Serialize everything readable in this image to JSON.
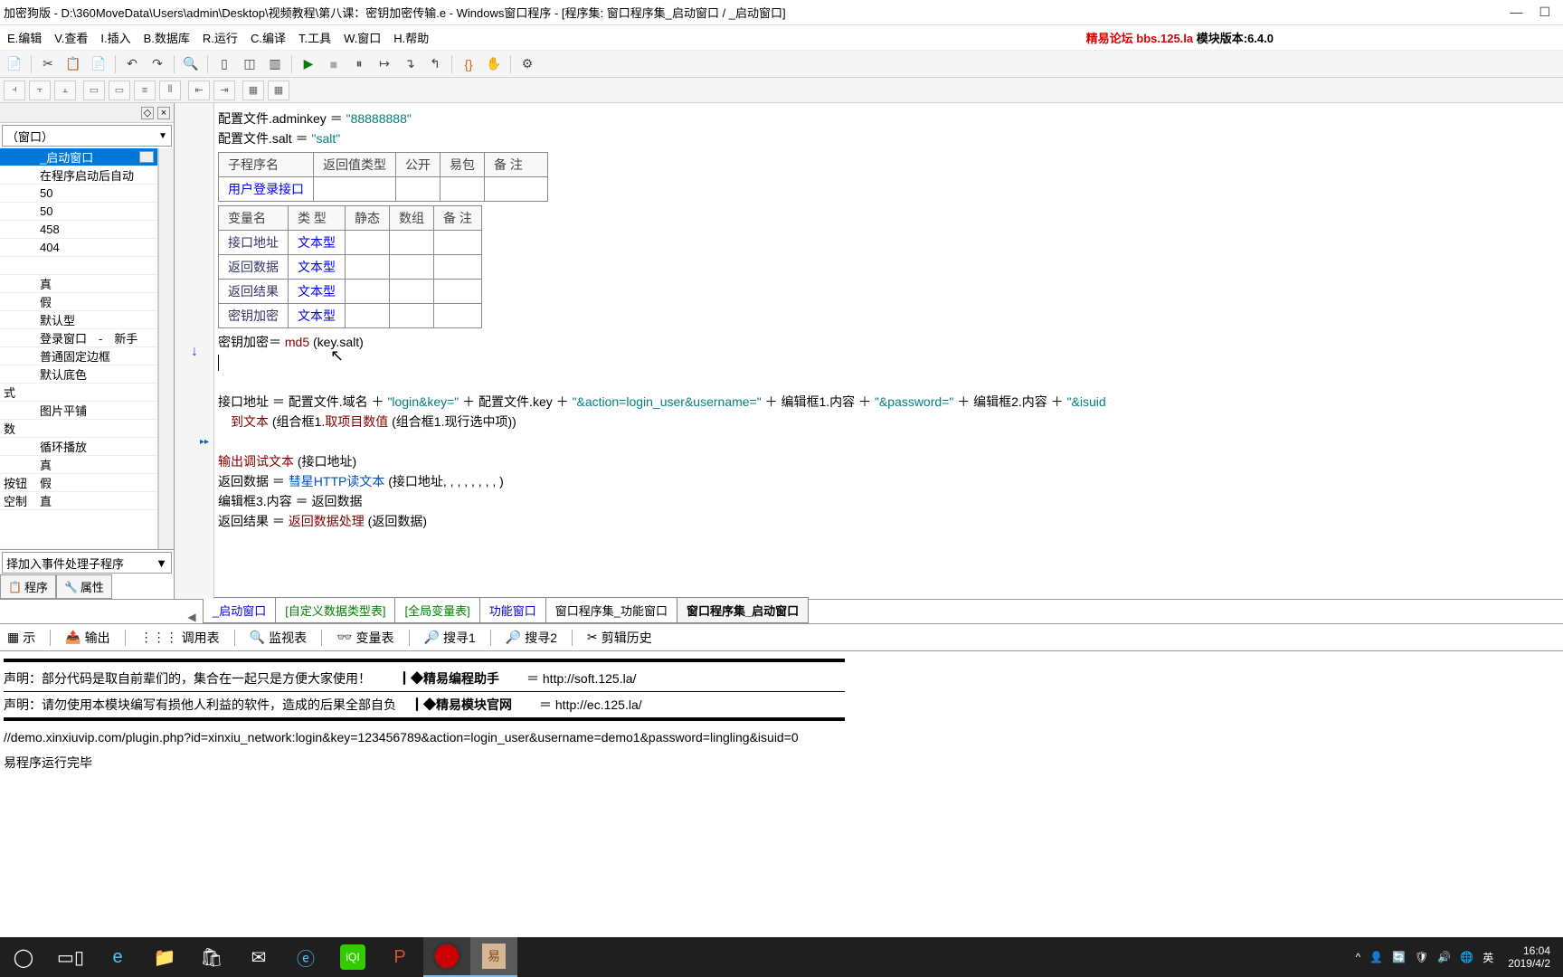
{
  "title": "加密狗版 - D:\\360MoveData\\Users\\admin\\Desktop\\视频教程\\第八课：密钥加密传输.e - Windows窗口程序 - [程序集: 窗口程序集_启动窗口 / _启动窗口]",
  "menus": [
    "E.编辑",
    "V.查看",
    "I.插入",
    "B.数据库",
    "R.运行",
    "C.编译",
    "T.工具",
    "W.窗口",
    "H.帮助"
  ],
  "brand_red": "精易论坛 bbs.125.la ",
  "brand_black": "模块版本:6.4.0",
  "left": {
    "combo": "（窗口）",
    "rows": [
      {
        "a": "",
        "b": "_启动窗口",
        "sel": true,
        "ell": true
      },
      {
        "a": "",
        "b": "在程序启动后自动"
      },
      {
        "a": "",
        "b": "50"
      },
      {
        "a": "",
        "b": "50"
      },
      {
        "a": "",
        "b": "458"
      },
      {
        "a": "",
        "b": "404"
      },
      {
        "a": "",
        "b": ""
      },
      {
        "a": "",
        "b": "真"
      },
      {
        "a": "",
        "b": "假"
      },
      {
        "a": "",
        "b": "默认型"
      },
      {
        "a": "",
        "b": "登录窗口　-　新手"
      },
      {
        "a": "",
        "b": "普通固定边框"
      },
      {
        "a": "",
        "b": "默认底色"
      },
      {
        "a": "式",
        "b": ""
      },
      {
        "a": "",
        "b": "图片平铺"
      },
      {
        "a": "数",
        "b": ""
      },
      {
        "a": "",
        "b": "循环播放"
      },
      {
        "a": "",
        "b": "真"
      },
      {
        "a": "按钮",
        "b": "假"
      },
      {
        "a": "空制",
        "b": "直"
      }
    ],
    "addevent": "择加入事件处理子程序",
    "tabs": [
      {
        "icon": "📋",
        "label": "程序"
      },
      {
        "icon": "🔧",
        "label": "属性"
      }
    ]
  },
  "code": {
    "l1a": "配置文件.adminkey ＝ ",
    "l1b": "\"88888888\"",
    "l2a": "配置文件.salt ＝ ",
    "l2b": "\"salt\"",
    "th1": [
      "子程序名",
      "返回值类型",
      "公开",
      "易包",
      "备 注"
    ],
    "tr1": [
      "用户登录接口",
      "",
      "",
      "",
      ""
    ],
    "th2": [
      "变量名",
      "类 型",
      "静态",
      "数组",
      "备 注"
    ],
    "tr2a": [
      "接口地址",
      "文本型",
      "",
      "",
      ""
    ],
    "tr2b": [
      "返回数据",
      "文本型",
      "",
      "",
      ""
    ],
    "tr2c": [
      "返回结果",
      "文本型",
      "",
      "",
      ""
    ],
    "tr2d": [
      "密钥加密",
      "文本型",
      "",
      "",
      ""
    ],
    "l3a": "密钥加密＝ ",
    "l3fn": "md5",
    "l3b": " (key.salt)",
    "l4a": "接口地址 ＝ 配置文件.域名 ＋ ",
    "l4s1": "\"login&key=\"",
    "l4b": " ＋ 配置文件.key ＋ ",
    "l4s2": "\"&action=login_user&username=\"",
    "l4c": " ＋ 编辑框1.内容 ＋ ",
    "l4s3": "\"&password=\"",
    "l4d": " ＋ 编辑框2.内容 ＋ ",
    "l4s4": "\"&isuid",
    "l5a": "到文本",
    "l5b": " (组合框1.",
    "l5fn": "取项目数值",
    "l5c": " (组合框1.现行选中项))",
    "l6fn": "输出调试文本",
    "l6a": " (接口地址)",
    "l7a": "返回数据 ＝ ",
    "l7fn": "彗星HTTP读文本",
    "l7b": " (接口地址, , , , , , , , )",
    "l8": "编辑框3.内容 ＝ 返回数据",
    "l9a": "返回结果 ＝ ",
    "l9fn": "返回数据处理",
    "l9b": " (返回数据)"
  },
  "etabs": [
    "_启动窗口",
    "[自定义数据类型表]",
    "[全局变量表]",
    "功能窗口",
    "窗口程序集_功能窗口",
    "窗口程序集_启动窗口"
  ],
  "btabs": [
    {
      "icon": "▦",
      "label": "示"
    },
    {
      "icon": "📤",
      "label": "输出"
    },
    {
      "icon": "⋮⋮⋮",
      "label": "调用表"
    },
    {
      "icon": "🔍",
      "label": "监视表"
    },
    {
      "icon": "👓",
      "label": "变量表"
    },
    {
      "icon": "🔎",
      "label": "搜寻1"
    },
    {
      "icon": "🔎",
      "label": "搜寻2"
    },
    {
      "icon": "✂",
      "label": "剪辑历史"
    }
  ],
  "output": {
    "r1a": "声明：部分代码是取自前辈们的，集合在一起只是方便大家使用！",
    "r1b": "┃◆精易编程助手",
    "r1c": "＝ http://soft.125.la/",
    "r2a": "声明：请勿使用本模块编写有损他人利益的软件，造成的后果全部自负",
    "r2b": "┃◆精易模块官网",
    "r2c": "＝ http://ec.125.la/",
    "r3": "//demo.xinxiuvip.com/plugin.php?id=xinxiu_network:login&key=123456789&action=login_user&username=demo1&password=lingling&isuid=0",
    "r4": "易程序运行完毕"
  },
  "tray": {
    "time": "16:04",
    "date": "2019/4/2",
    "ime": "英"
  }
}
